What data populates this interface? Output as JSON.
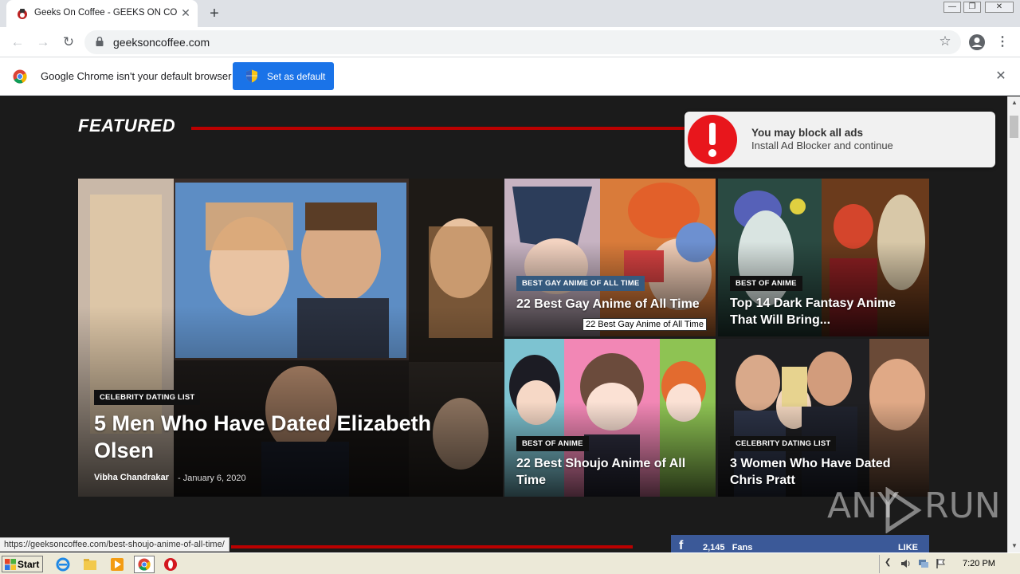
{
  "browser": {
    "tab_title": "Geeks On Coffee - GEEKS ON COFFEE",
    "tab_close": "✕",
    "new_tab": "+",
    "url": "geeksoncoffee.com",
    "window_min": "—",
    "window_max": "❐",
    "window_close": "✕"
  },
  "infobar": {
    "message": "Google Chrome isn't your default browser",
    "button_label": "Set as default",
    "close": "✕"
  },
  "page": {
    "section_title": "FEATURED",
    "main": {
      "category": "CELEBRITY DATING LIST",
      "title": "5 Men Who Have Dated Elizabeth Olsen",
      "author": "Vibha Chandrakar",
      "date": "- January 6, 2020"
    },
    "cards": [
      {
        "category": "BEST GAY ANIME OF ALL TIME",
        "title": "22 Best Gay Anime of All Time"
      },
      {
        "category": "BEST OF ANIME",
        "title": "Top 14 Dark Fantasy Anime That Will Bring..."
      },
      {
        "category": "BEST OF ANIME",
        "title": "22 Best Shoujo Anime of All Time"
      },
      {
        "category": "CELEBRITY DATING LIST",
        "title": "3 Women Who Have Dated Chris Pratt"
      }
    ],
    "tooltip": "22 Best Gay Anime of All Time",
    "facebook": {
      "icon": "f",
      "count": "2,145",
      "unit": "Fans",
      "like": "LIKE"
    }
  },
  "ad_popup": {
    "title": "You may block all ads",
    "subtitle": "Install Ad Blocker and continue"
  },
  "watermark": {
    "left": "ANY",
    "right": "RUN"
  },
  "status_url": "https://geeksoncoffee.com/best-shoujo-anime-of-all-time/",
  "taskbar": {
    "start": "Start",
    "clock": "7:20 PM"
  },
  "colors": {
    "accent_red": "#bb0000",
    "chrome_blue": "#1a73e8",
    "facebook": "#3b5998"
  }
}
